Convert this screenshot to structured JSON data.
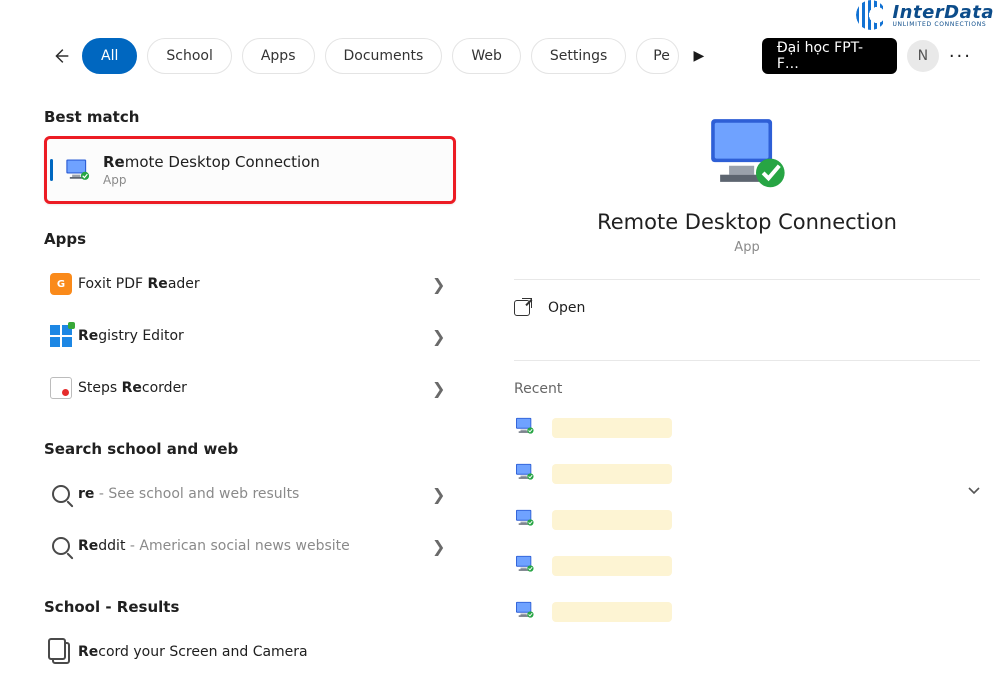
{
  "watermark": {
    "brand": "InterData",
    "tagline": "UNLIMITED CONNECTIONS"
  },
  "topbar": {
    "tabs": [
      "All",
      "School",
      "Apps",
      "Documents",
      "Web",
      "Settings",
      "Pe"
    ],
    "active_index": 0,
    "badge": "Đại học FPT- F…",
    "avatar_initial": "N"
  },
  "left": {
    "sections": {
      "best": {
        "heading": "Best match"
      },
      "apps": {
        "heading": "Apps"
      },
      "web": {
        "heading": "Search school and web"
      },
      "school": {
        "heading": "School - Results"
      }
    },
    "best_match": {
      "title_bold": "Re",
      "title_rest": "mote Desktop Connection",
      "subtitle": "App"
    },
    "apps": [
      {
        "bold": "Re",
        "rest": "ader",
        "prefix": "Foxit PDF "
      },
      {
        "bold": "Re",
        "rest": "gistry Editor",
        "prefix": ""
      },
      {
        "bold": "Re",
        "rest": "corder",
        "prefix": "Steps "
      }
    ],
    "web": [
      {
        "bold": "re",
        "suffix": " - See school and web results",
        "prefix": ""
      },
      {
        "bold": "Re",
        "suffix": " - American social news website",
        "prefix": "",
        "rest": "ddit"
      }
    ],
    "school": [
      {
        "bold": "Re",
        "rest": "cord your Screen and Camera",
        "prefix": ""
      }
    ]
  },
  "right": {
    "title": "Remote Desktop Connection",
    "subtitle": "App",
    "open_label": "Open",
    "recent_heading": "Recent",
    "recent_count": 5
  }
}
